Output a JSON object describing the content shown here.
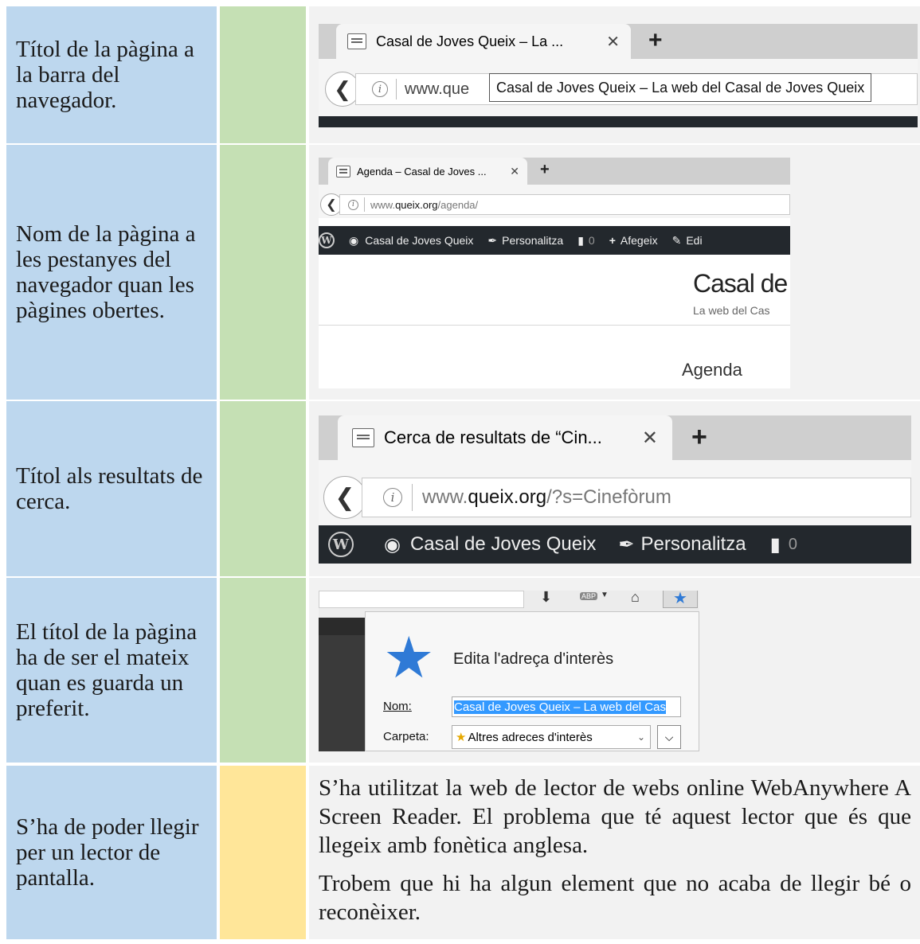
{
  "rows": [
    {
      "label": "Títol de la pàgina a la barra del navegador.",
      "shot": {
        "tab_title": "Casal de Joves Queix – La ...",
        "tab_close": "✕",
        "new_tab": "+",
        "url": "www.que",
        "url_domain": "que",
        "tooltip": "Casal de Joves Queix – La web del Casal de Joves Queix"
      }
    },
    {
      "label": "Nom de la pàgina a les pestanyes del navegador quan les pàgines obertes.",
      "shot": {
        "tab_title": "Agenda – Casal de Joves ...",
        "tab_close": "✕",
        "new_tab": "+",
        "url_prefix": "www.",
        "url_domain": "queix.org",
        "url_path": "/agenda/",
        "wp_items": [
          "Casal de Joves Queix",
          "Personalitza",
          "0",
          "Afegeix",
          "Edi"
        ],
        "site_title": "Casal de Jo",
        "site_tagline": "La web del Cas",
        "page_heading": "Agenda"
      }
    },
    {
      "label": "Títol als resultats de cerca.",
      "shot": {
        "tab_title": "Cerca de resultats de “Cin...",
        "tab_close": "✕",
        "new_tab": "+",
        "url_prefix": "www.",
        "url_domain": "queix.org",
        "url_path": "/?s=Cinefòrum",
        "wp_items": [
          "Casal de Joves Queix",
          "Personalitza",
          "0"
        ]
      }
    },
    {
      "label": "El títol de la pàgina ha de ser el mateix quan es guarda un preferit.",
      "shot": {
        "dialog_title": "Edita l'adreça d'interès",
        "name_label": "Nom:",
        "name_value": "Casal de Joves Queix – La web del Cas",
        "folder_label": "Carpeta:",
        "folder_value": "Altres adreces d'interès",
        "abp": "ABP"
      }
    },
    {
      "label": "S’ha de poder llegir per un lector de pantalla.",
      "paragraphs": [
        "S’ha utilitzat la web de lector de webs online WebAnywhere A Screen Reader. El problema que té aquest lector que és que llegeix amb fonètica anglesa.",
        "Trobem que hi ha algun element que no acaba de llegir bé o reconèixer."
      ]
    }
  ],
  "colors": {
    "label_bg": "#bdd7ee",
    "mark_green": "#c5e0b4",
    "mark_yellow": "#ffe699",
    "content_bg": "#f2f2f2",
    "wp_bar": "#23282d",
    "star_blue": "#2f7ad6"
  }
}
